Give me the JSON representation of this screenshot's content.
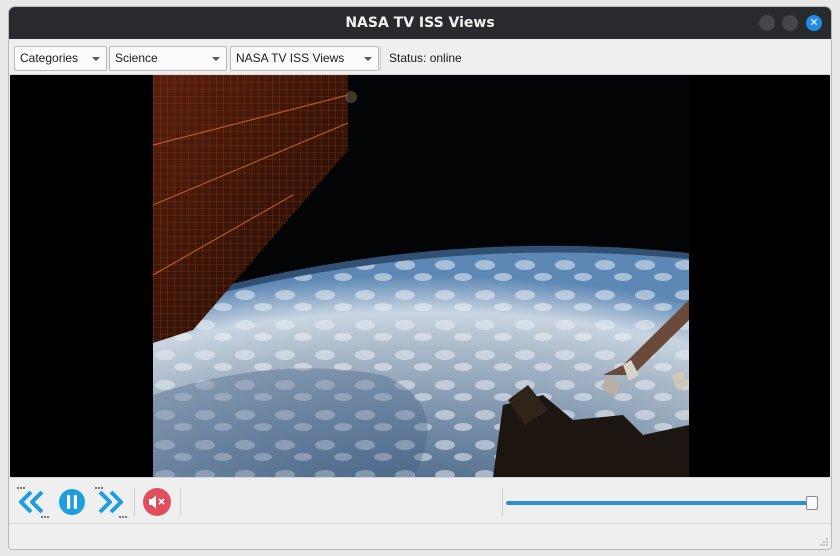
{
  "window": {
    "title": "NASA TV ISS Views",
    "close_glyph": "✕"
  },
  "toolbar": {
    "categories_combo": "Categories",
    "genre_combo": "Science",
    "channel_combo": "NASA TV ISS Views",
    "status": "Status: online"
  },
  "icons": {
    "previous": "chevron-double-left-icon",
    "pause": "pause-icon",
    "next": "chevron-double-right-icon",
    "mute": "speaker-muted-icon"
  },
  "player": {
    "volume_level": 1.0
  },
  "colors": {
    "accent": "#1d8ce6",
    "control_blue": "#1e9de0",
    "mute_red": "#e0505c",
    "titlebar": "#282a2e"
  }
}
